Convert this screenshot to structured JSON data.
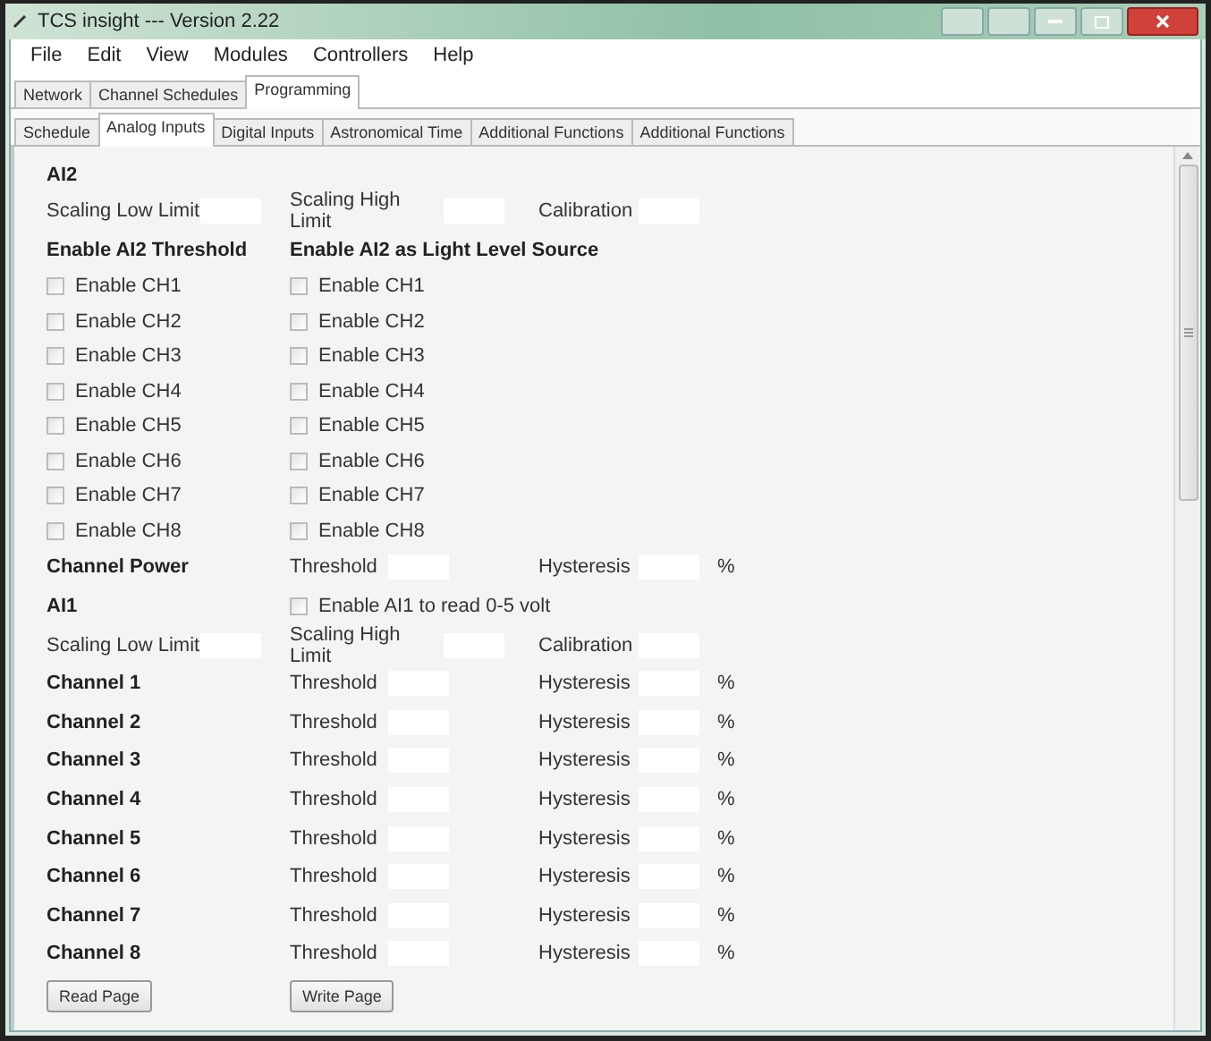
{
  "window": {
    "title": "TCS insight --- Version 2.22"
  },
  "menu": [
    "File",
    "Edit",
    "View",
    "Modules",
    "Controllers",
    "Help"
  ],
  "tabs": [
    {
      "label": "Network",
      "selected": false
    },
    {
      "label": "Channel Schedules",
      "selected": false
    },
    {
      "label": "Programming",
      "selected": true
    }
  ],
  "subtabs": [
    {
      "label": "Schedule",
      "selected": false
    },
    {
      "label": "Analog Inputs",
      "selected": true
    },
    {
      "label": "Digital Inputs",
      "selected": false
    },
    {
      "label": "Astronomical Time",
      "selected": false
    },
    {
      "label": "Additional Functions",
      "selected": false
    },
    {
      "label": "Additional Functions",
      "selected": false
    }
  ],
  "ai2": {
    "heading": "AI2",
    "scaling": [
      "Scaling Low Limit",
      "Scaling High Limit",
      "Calibration"
    ],
    "threshold_heading": "Enable AI2 Threshold",
    "light_heading": "Enable AI2 as Light Level Source",
    "threshold_checks": [
      {
        "label": "Enable CH1",
        "checked": false
      },
      {
        "label": "Enable CH2",
        "checked": false
      },
      {
        "label": "Enable CH3",
        "checked": false
      },
      {
        "label": "Enable CH4",
        "checked": false
      },
      {
        "label": "Enable CH5",
        "checked": false
      },
      {
        "label": "Enable CH6",
        "checked": false
      },
      {
        "label": "Enable CH7",
        "checked": false
      },
      {
        "label": "Enable CH8",
        "checked": false
      }
    ],
    "light_checks": [
      {
        "label": "Enable CH1",
        "checked": false
      },
      {
        "label": "Enable CH2",
        "checked": false
      },
      {
        "label": "Enable CH3",
        "checked": false
      },
      {
        "label": "Enable CH4",
        "checked": false
      },
      {
        "label": "Enable CH5",
        "checked": false
      },
      {
        "label": "Enable CH6",
        "checked": false
      },
      {
        "label": "Enable CH7",
        "checked": false
      },
      {
        "label": "Enable CH8",
        "checked": false
      }
    ]
  },
  "channel_power": {
    "label": "Channel Power",
    "threshold": "Threshold",
    "hysteresis": "Hysteresis",
    "unit": "%"
  },
  "ai1": {
    "heading": "AI1",
    "check": {
      "label": "Enable AI1 to read 0-5 volt",
      "checked": false
    },
    "scaling": [
      "Scaling Low Limit",
      "Scaling High Limit",
      "Calibration"
    ],
    "channels": [
      {
        "label": "Channel 1",
        "threshold": "Threshold",
        "hysteresis": "Hysteresis",
        "unit": "%"
      },
      {
        "label": "Channel 2",
        "threshold": "Threshold",
        "hysteresis": "Hysteresis",
        "unit": "%"
      },
      {
        "label": "Channel 3",
        "threshold": "Threshold",
        "hysteresis": "Hysteresis",
        "unit": "%"
      },
      {
        "label": "Channel 4",
        "threshold": "Threshold",
        "hysteresis": "Hysteresis",
        "unit": "%"
      },
      {
        "label": "Channel 5",
        "threshold": "Threshold",
        "hysteresis": "Hysteresis",
        "unit": "%"
      },
      {
        "label": "Channel 6",
        "threshold": "Threshold",
        "hysteresis": "Hysteresis",
        "unit": "%"
      },
      {
        "label": "Channel 7",
        "threshold": "Threshold",
        "hysteresis": "Hysteresis",
        "unit": "%"
      },
      {
        "label": "Channel 8",
        "threshold": "Threshold",
        "hysteresis": "Hysteresis",
        "unit": "%"
      }
    ]
  },
  "buttons": [
    "Read Page",
    "Write Page"
  ]
}
